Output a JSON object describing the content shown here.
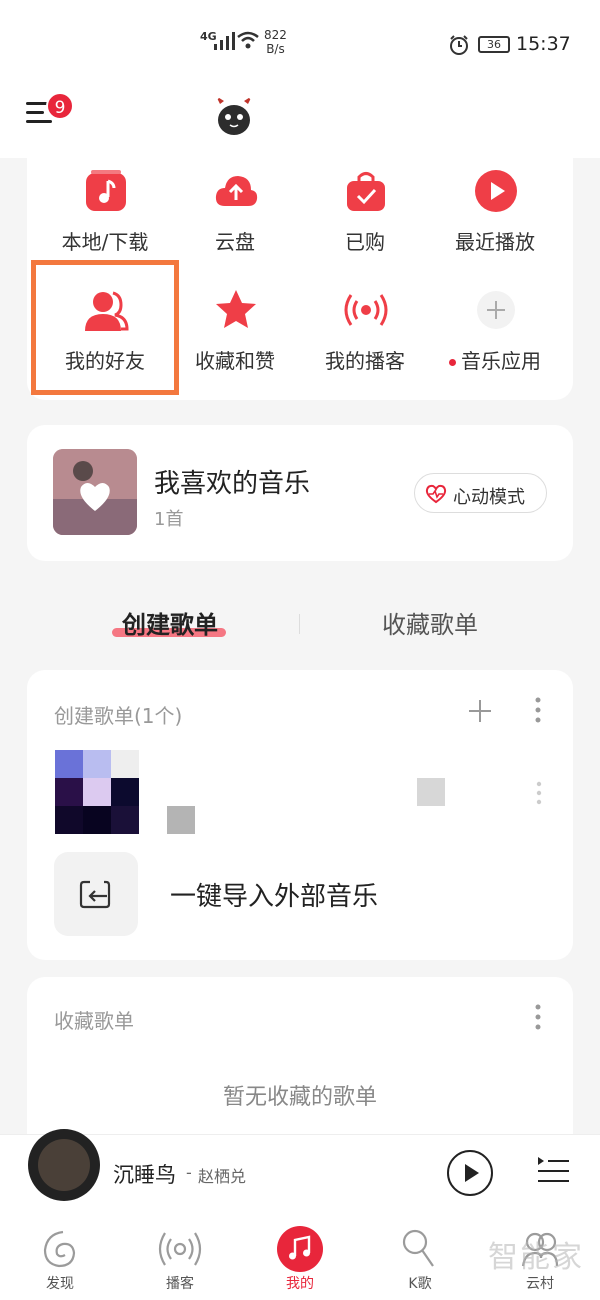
{
  "status_bar": {
    "network": "4G",
    "speed_value": "822",
    "speed_unit": "B/s",
    "battery": "36",
    "time": "15:37"
  },
  "header": {
    "notification_badge": "9"
  },
  "quick_grid": {
    "items": [
      {
        "label": "本地/下载",
        "icon": "music-note-icon"
      },
      {
        "label": "云盘",
        "icon": "cloud-upload-icon"
      },
      {
        "label": "已购",
        "icon": "shopping-bag-icon"
      },
      {
        "label": "最近播放",
        "icon": "play-circle-icon"
      },
      {
        "label": "我的好友",
        "icon": "friends-icon"
      },
      {
        "label": "收藏和赞",
        "icon": "star-icon"
      },
      {
        "label": "我的播客",
        "icon": "podcast-icon"
      },
      {
        "label": "音乐应用",
        "icon": "add-icon"
      }
    ]
  },
  "liked_music": {
    "title": "我喜欢的音乐",
    "count": "1首",
    "heart_mode_label": "心动模式"
  },
  "tabs": {
    "created": "创建歌单",
    "collected": "收藏歌单"
  },
  "created_playlists": {
    "header": "创建歌单(1个)",
    "import_label": "一键导入外部音乐"
  },
  "collected_playlists": {
    "header": "收藏歌单",
    "empty_text": "暂无收藏的歌单"
  },
  "mini_player": {
    "song": "沉睡鸟",
    "separator": "-",
    "artist": "赵栖兑"
  },
  "bottom_nav": {
    "items": [
      {
        "label": "发现",
        "active": false
      },
      {
        "label": "播客",
        "active": false
      },
      {
        "label": "我的",
        "active": true
      },
      {
        "label": "K歌",
        "active": false
      },
      {
        "label": "云村",
        "active": false
      }
    ]
  },
  "watermark": "智能家",
  "colors": {
    "accent": "#e8263b",
    "highlight_box": "#f3783e",
    "background": "#f5f5f5"
  }
}
